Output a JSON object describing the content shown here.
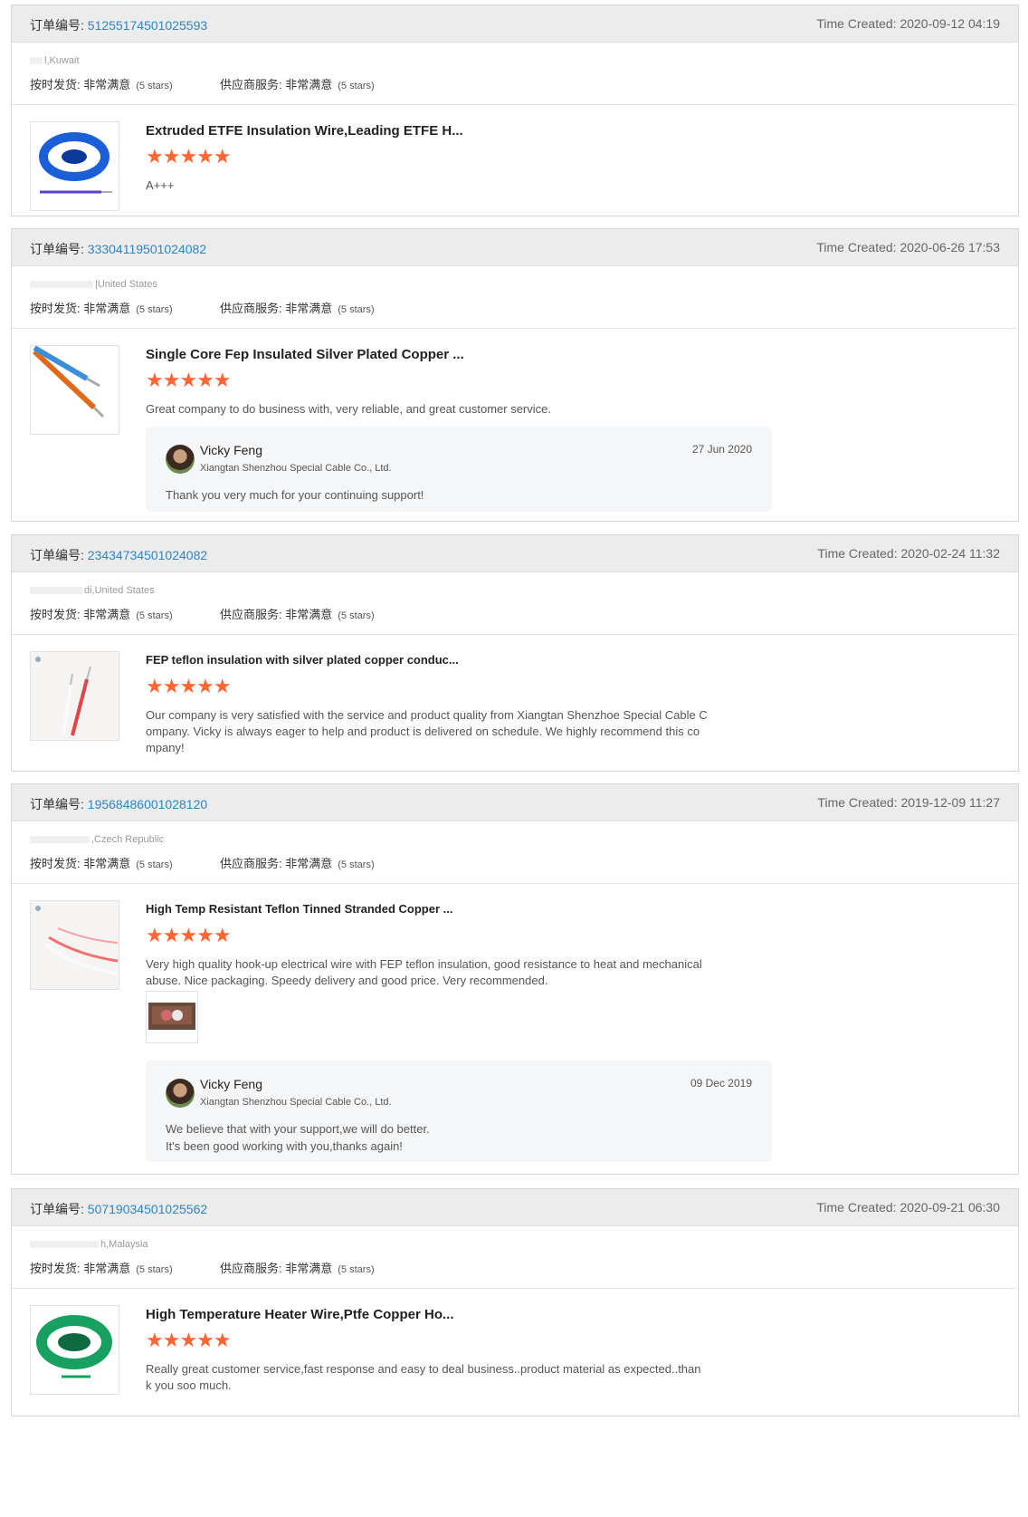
{
  "labels": {
    "order_no": "订单编号:",
    "time_created": "Time Created:",
    "ontime": "按时发货:",
    "supplier": "供应商服务:",
    "very_satisfied": "非常满意",
    "five_stars": "(5 stars)"
  },
  "reviews": [
    {
      "order": "51255174501025593",
      "time": "2020-09-12 04:19",
      "location": "l,Kuwait",
      "product": "Extruded ETFE Insulation Wire,Leading ETFE H...",
      "stars": "★★★★★",
      "text": "A+++"
    },
    {
      "order": "33304119501024082",
      "time": "2020-06-26 17:53",
      "location": "|United States",
      "product": "Single Core Fep Insulated Silver Plated Copper ...",
      "stars": "★★★★★",
      "text": "Great company to do business with, very reliable, and great customer service.",
      "reply": {
        "name": "Vicky Feng",
        "company": "Xiangtan Shenzhou Special Cable Co., Ltd.",
        "date": "27 Jun 2020",
        "message": "Thank you very much for your continuing support!"
      }
    },
    {
      "order": "23434734501024082",
      "time": "2020-02-24 11:32",
      "location": "di,United States",
      "product": "FEP teflon insulation with silver plated copper conduc...",
      "stars": "★★★★★",
      "text_lines": [
        "Our company is very satisfied with the service and product quality from Xiangtan Shenzhoe Special Cable C",
        "ompany.  Vicky is always eager to help and product is delivered on schedule.  We highly recommend this co",
        "mpany!"
      ]
    },
    {
      "order": "19568486001028120",
      "time": "2019-12-09 11:27",
      "location": ",Czech Republic",
      "product": "High Temp Resistant Teflon Tinned Stranded Copper ...",
      "stars": "★★★★★",
      "text_lines": [
        "Very high quality hook-up electrical wire with FEP teflon insulation, good resistance to heat and mechanical",
        "abuse. Nice packaging. Speedy delivery and good price. Very recommended."
      ],
      "reply": {
        "name": "Vicky Feng",
        "company": "Xiangtan Shenzhou Special Cable Co., Ltd.",
        "date": "09 Dec 2019",
        "message_lines": [
          "We believe that with your support,we will do better.",
          "It's been good working with you,thanks again!"
        ]
      }
    },
    {
      "order": "50719034501025562",
      "time": "2020-09-21 06:30",
      "location": "h,Malaysia",
      "product": "High Temperature Heater Wire,Ptfe Copper Ho...",
      "stars": "★★★★★",
      "text_lines": [
        "Really great customer service,fast response and easy to deal business..product material as expected..than",
        "k you soo much."
      ]
    }
  ]
}
